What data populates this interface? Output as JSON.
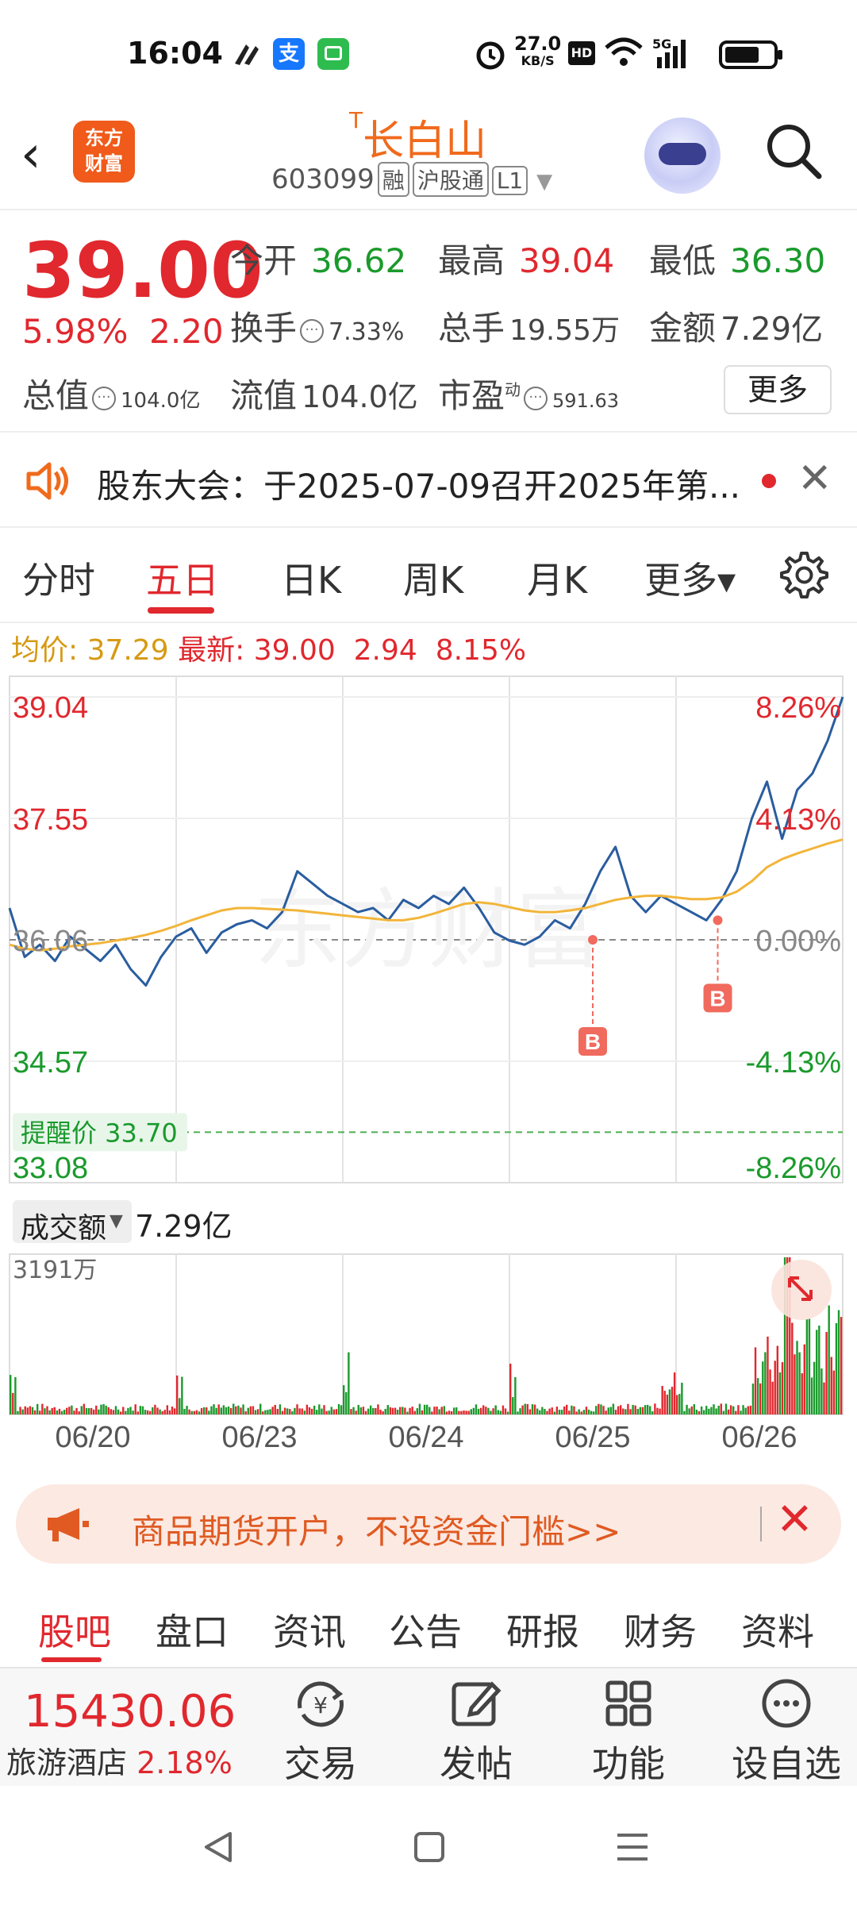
{
  "status": {
    "time": "16:04",
    "net_speed": "27.0",
    "net_unit": "KB/S",
    "hd": "HD",
    "signal": "5G",
    "alipay_glyph": "支"
  },
  "header": {
    "back_glyph": "‹",
    "logo_line1": "东方",
    "logo_line2": "财富",
    "title_prefix": "T",
    "title": "长白山",
    "code": "603099",
    "tags": [
      "融",
      "沪股通",
      "L1"
    ]
  },
  "quote": {
    "price": "39.00",
    "change_pct": "5.98%",
    "change_abs": "2.20",
    "open_label": "今开",
    "open": "36.62",
    "high_label": "最高",
    "high": "39.04",
    "low_label": "最低",
    "low": "36.30",
    "turnover_label": "换手",
    "turnover": "7.33%",
    "volume_label": "总手",
    "volume": "19.55万",
    "amount_label": "金额",
    "amount": "7.29亿",
    "mktcap_label": "总值",
    "mktcap": "104.0亿",
    "float_label": "流值",
    "float": "104.0亿",
    "pe_label": "市盈",
    "pe_sup": "动",
    "pe": "591.63",
    "more_label": "更多",
    "info_glyph": "···"
  },
  "notice": {
    "text": "股东大会：于2025-07-09召开2025年第...",
    "close_glyph": "✕"
  },
  "tabs": [
    {
      "label": "分时"
    },
    {
      "label": "五日"
    },
    {
      "label": "日K"
    },
    {
      "label": "周K"
    },
    {
      "label": "月K"
    },
    {
      "label": "更多▾"
    }
  ],
  "summary": {
    "avg_label": "均价:",
    "avg": "37.29",
    "latest_label": "最新:",
    "latest": "39.00",
    "chg": "2.94",
    "pct": "8.15%"
  },
  "chart_data": {
    "type": "line",
    "watermark": "东方财富",
    "y_left_ticks": [
      "39.04",
      "37.55",
      "36.06",
      "34.57",
      "33.08"
    ],
    "y_right_ticks": [
      "8.26%",
      "4.13%",
      "0.00%",
      "-4.13%",
      "-8.26%"
    ],
    "x_labels": [
      "06/20",
      "06/23",
      "06/24",
      "06/25",
      "06/26"
    ],
    "ylim": [
      33.08,
      39.04
    ],
    "prev_close": 36.06,
    "alert_label": "提醒价 33.70",
    "alert_price": 33.7,
    "buy_marker": "B",
    "buy_points": [
      {
        "day": 4,
        "price": 36.06
      },
      {
        "day": 5,
        "price": 36.3
      }
    ],
    "series": [
      {
        "name": "price",
        "values": [
          36.45,
          35.85,
          36.0,
          35.8,
          36.1,
          35.95,
          35.8,
          36.0,
          35.7,
          35.5,
          35.85,
          36.1,
          36.2,
          35.9,
          36.15,
          36.25,
          36.3,
          36.2,
          36.4,
          36.9,
          36.75,
          36.6,
          36.5,
          36.4,
          36.45,
          36.3,
          36.55,
          36.45,
          36.6,
          36.5,
          36.7,
          36.45,
          36.15,
          36.05,
          36.0,
          36.1,
          36.3,
          36.2,
          36.5,
          36.9,
          37.2,
          36.6,
          36.4,
          36.6,
          36.5,
          36.4,
          36.3,
          36.55,
          36.9,
          37.55,
          38.0,
          37.3,
          37.9,
          38.1,
          38.5,
          39.04
        ]
      },
      {
        "name": "avg",
        "values": [
          36.0,
          35.95,
          35.93,
          35.95,
          35.98,
          36.0,
          36.02,
          36.05,
          36.08,
          36.12,
          36.17,
          36.23,
          36.3,
          36.36,
          36.42,
          36.45,
          36.45,
          36.44,
          36.43,
          36.42,
          36.4,
          36.38,
          36.36,
          36.34,
          36.32,
          36.3,
          36.3,
          36.33,
          36.38,
          36.44,
          36.5,
          36.52,
          36.5,
          36.46,
          36.42,
          36.4,
          36.4,
          36.42,
          36.45,
          36.5,
          36.55,
          36.58,
          36.6,
          36.6,
          36.58,
          36.56,
          36.56,
          36.58,
          36.65,
          36.78,
          36.95,
          37.05,
          37.12,
          37.18,
          37.24,
          37.29
        ]
      }
    ]
  },
  "volume_chart": {
    "selector": "成交额",
    "amount": "7.29亿",
    "max_label": "3191万"
  },
  "promo": {
    "text": "商品期货开户，不设资金门槛>>",
    "close_glyph": "✕"
  },
  "bottom_tabs": [
    "股吧",
    "盘口",
    "资讯",
    "公告",
    "研报",
    "财务",
    "资料"
  ],
  "toolbar": {
    "index": "15430.06",
    "sector": "旅游酒店",
    "sector_pct": "2.18%",
    "buttons": [
      {
        "label": "交易",
        "icon": "trade-icon"
      },
      {
        "label": "发帖",
        "icon": "post-icon"
      },
      {
        "label": "功能",
        "icon": "grid-icon"
      },
      {
        "label": "设自选",
        "icon": "more-icon"
      }
    ]
  }
}
